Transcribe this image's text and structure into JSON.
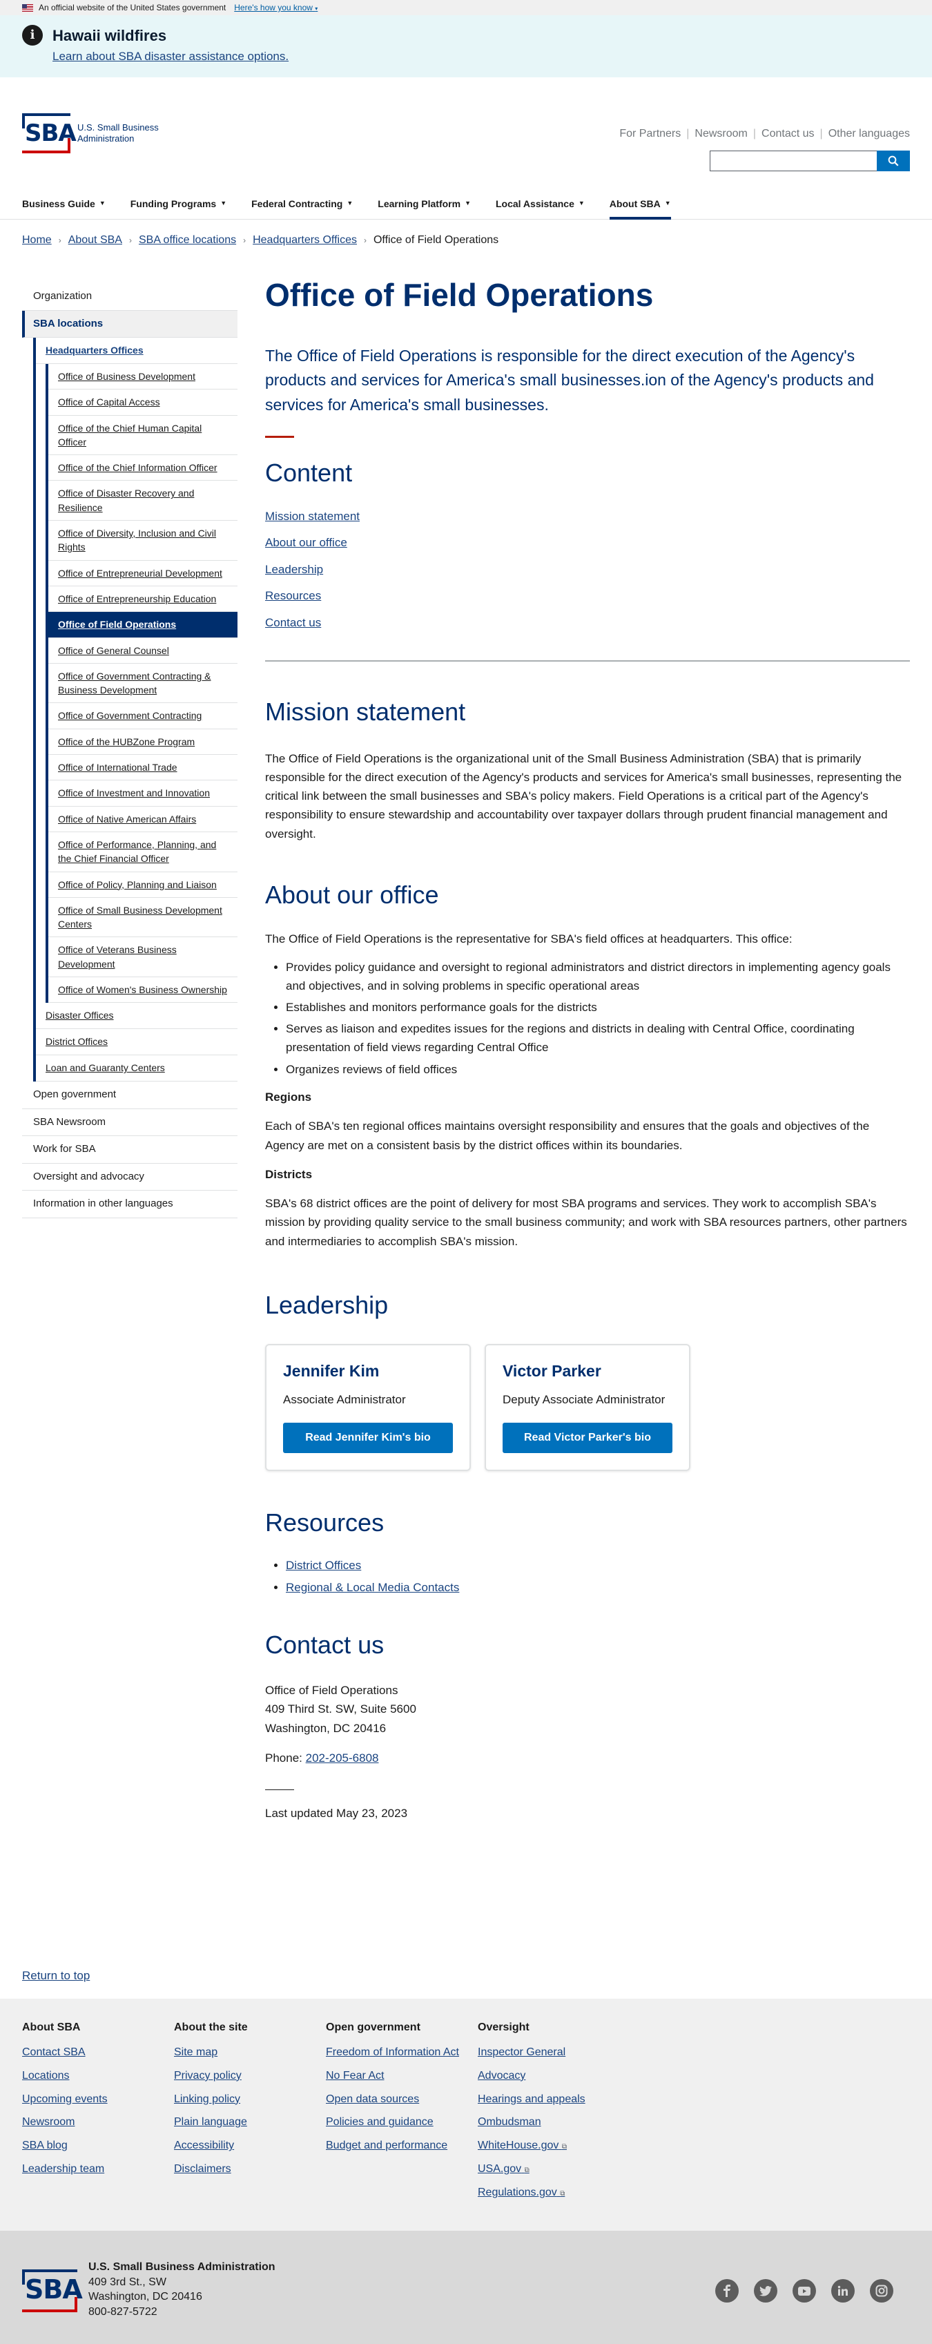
{
  "gov_banner": {
    "official_text": "An official website of the United States government",
    "how_link": "Here's how you know"
  },
  "alert": {
    "title": "Hawaii wildfires",
    "link": "Learn about SBA disaster assistance options."
  },
  "header": {
    "logo_mark": "SBA",
    "logo_name": "U.S. Small Business Administration",
    "utility_links": [
      "For Partners",
      "Newsroom",
      "Contact us",
      "Other languages"
    ],
    "search_placeholder": ""
  },
  "nav": {
    "items": [
      "Business Guide",
      "Funding Programs",
      "Federal Contracting",
      "Learning Platform",
      "Local Assistance",
      "About SBA"
    ],
    "active_index": 5
  },
  "breadcrumb": {
    "items": [
      "Home",
      "About SBA",
      "SBA office locations",
      "Headquarters Offices"
    ],
    "current": "Office of Field Operations"
  },
  "sidenav": {
    "top_before": [
      "Organization"
    ],
    "sba_locations": "SBA locations",
    "hq": "Headquarters Offices",
    "hq_items": [
      "Office of Business Development",
      "Office of Capital Access",
      "Office of the Chief Human Capital Officer",
      "Office of the Chief Information Officer",
      "Office of Disaster Recovery and Resilience",
      "Office of Diversity, Inclusion and Civil Rights",
      "Office of Entrepreneurial Development",
      "Office of Entrepreneurship Education",
      "Office of Field Operations",
      "Office of General Counsel",
      "Office of Government Contracting & Business Development",
      "Office of Government Contracting",
      "Office of the HUBZone Program",
      "Office of International Trade",
      "Office of Investment and Innovation",
      "Office of Native American Affairs",
      "Office of Performance, Planning, and the Chief Financial Officer",
      "Office of Policy, Planning and Liaison",
      "Office of Small Business Development Centers",
      "Office of Veterans Business Development",
      "Office of Women's Business Ownership"
    ],
    "current_index": 8,
    "locations_after": [
      "Disaster Offices",
      "District Offices",
      "Loan and Guaranty Centers"
    ],
    "top_after": [
      "Open government",
      "SBA Newsroom",
      "Work for SBA",
      "Oversight and advocacy",
      "Information in other languages"
    ]
  },
  "page": {
    "title": "Office of Field Operations",
    "lead": "The Office of Field Operations is responsible for the direct execution of the Agency's products and services for America's small businesses.ion of the Agency's products and services for America's small businesses.",
    "content_heading": "Content",
    "toc": [
      "Mission statement",
      "About our office",
      "Leadership",
      "Resources",
      "Contact us"
    ],
    "mission_heading": "Mission statement",
    "mission_text": "The Office of Field Operations is the organizational unit of the Small Business Administration (SBA) that is primarily responsible for the direct execution of the Agency's products and services for America's small businesses, representing the critical link between the small businesses and SBA's policy makers. Field Operations is a critical part of the Agency's responsibility to ensure stewardship and accountability over taxpayer dollars through prudent financial management and oversight.",
    "about_heading": "About our office",
    "about_intro": "The Office of Field Operations is the representative for SBA's field offices at headquarters. This office:",
    "about_bullets": [
      "Provides policy guidance and oversight to regional administrators and district directors in implementing agency goals and objectives, and in solving problems in specific operational areas",
      "Establishes and monitors performance goals for the districts",
      "Serves as liaison and expedites issues for the regions and districts in dealing with Central Office, coordinating presentation of field views regarding Central Office",
      "Organizes reviews of field offices"
    ],
    "regions_heading": "Regions",
    "regions_text": "Each of SBA's ten regional offices maintains oversight responsibility and ensures that the goals and objectives of the Agency are met on a consistent basis by the district offices within its boundaries.",
    "districts_heading": "Districts",
    "districts_text": "SBA's 68 district offices are the point of delivery for most SBA programs and services. They work to accomplish SBA's mission by providing quality service to the small business community; and work with SBA resources partners, other partners and intermediaries to accomplish SBA's mission.",
    "leadership_heading": "Leadership",
    "leaders": [
      {
        "name": "Jennifer Kim",
        "title": "Associate Administrator",
        "button": "Read Jennifer Kim's bio"
      },
      {
        "name": "Victor Parker",
        "title": "Deputy Associate Administrator",
        "button": "Read Victor Parker's bio"
      }
    ],
    "resources_heading": "Resources",
    "resources": [
      "District Offices",
      "Regional & Local Media Contacts"
    ],
    "contact_heading": "Contact us",
    "contact_lines": [
      "Office of Field Operations",
      "409 Third St. SW, Suite 5600",
      "Washington, DC 20416"
    ],
    "phone_label": "Phone:",
    "phone": "202-205-6808",
    "last_updated": "Last updated May 23, 2023"
  },
  "return_top": "Return to top",
  "footer": {
    "columns": [
      {
        "heading": "About SBA",
        "links": [
          "Contact SBA",
          "Locations",
          "Upcoming events",
          "Newsroom",
          "SBA blog",
          "Leadership team"
        ]
      },
      {
        "heading": "About the site",
        "links": [
          "Site map",
          "Privacy policy",
          "Linking policy",
          "Plain language",
          "Accessibility",
          "Disclaimers"
        ]
      },
      {
        "heading": "Open government",
        "links": [
          "Freedom of Information Act",
          "No Fear Act",
          "Open data sources",
          "Policies and guidance",
          "Budget and performance"
        ]
      },
      {
        "heading": "Oversight",
        "links": [
          "Inspector General",
          "Advocacy",
          "Hearings and appeals",
          "Ombudsman",
          "WhiteHouse.gov",
          "USA.gov",
          "Regulations.gov"
        ]
      }
    ],
    "external_link_icon": "external-link-icon"
  },
  "identifier": {
    "name": "U.S. Small Business Administration",
    "address1": "409 3rd St., SW",
    "address2": "Washington, DC 20416",
    "phone": "800-827-5722",
    "social_icons": [
      "facebook-icon",
      "twitter-icon",
      "youtube-icon",
      "linkedin-icon",
      "instagram-icon"
    ]
  },
  "colors": {
    "primary": "#002e6d",
    "link": "#1a4480",
    "button": "#0071bc",
    "accent_red": "#b51d09",
    "alert_bg": "#e7f6f8"
  }
}
